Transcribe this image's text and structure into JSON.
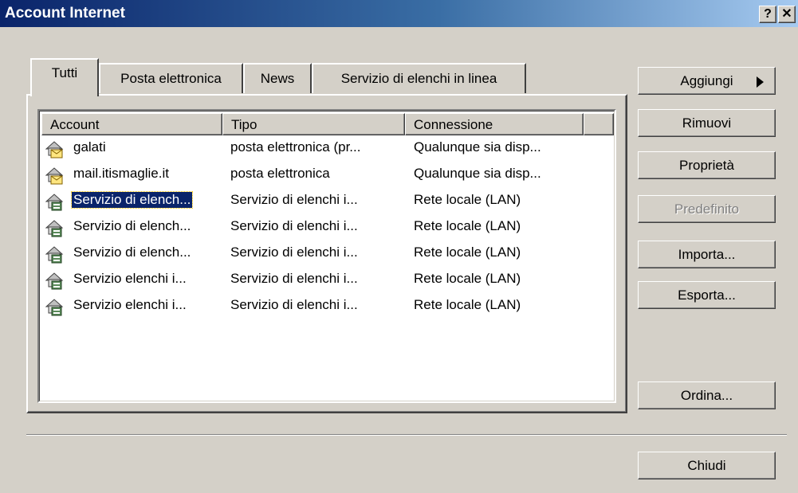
{
  "window": {
    "title": "Account Internet",
    "help_label": "?",
    "close_label": "✕"
  },
  "tabs": [
    {
      "label": "Tutti",
      "active": true
    },
    {
      "label": "Posta elettronica",
      "active": false
    },
    {
      "label": "News",
      "active": false
    },
    {
      "label": "Servizio di elenchi in linea",
      "active": false
    }
  ],
  "list": {
    "columns": [
      "Account",
      "Tipo",
      "Connessione"
    ],
    "rows": [
      {
        "icon": "mail-account-icon",
        "name": "galati",
        "tipo": "posta elettronica (pr...",
        "connessione": "Qualunque sia disp..."
      },
      {
        "icon": "mail-account-icon",
        "name": "mail.itismaglie.it",
        "tipo": "posta elettronica",
        "connessione": "Qualunque sia disp..."
      },
      {
        "icon": "directory-service-icon",
        "name": "Servizio di elench...",
        "tipo": "Servizio di elenchi i...",
        "connessione": "Rete locale (LAN)",
        "selected": true
      },
      {
        "icon": "directory-service-icon",
        "name": "Servizio di elench...",
        "tipo": "Servizio di elenchi i...",
        "connessione": "Rete locale (LAN)"
      },
      {
        "icon": "directory-service-icon",
        "name": "Servizio di elench...",
        "tipo": "Servizio di elenchi i...",
        "connessione": "Rete locale (LAN)"
      },
      {
        "icon": "directory-service-icon",
        "name": "Servizio elenchi i...",
        "tipo": "Servizio di elenchi i...",
        "connessione": "Rete locale (LAN)"
      },
      {
        "icon": "directory-service-icon",
        "name": "Servizio elenchi i...",
        "tipo": "Servizio di elenchi i...",
        "connessione": "Rete locale (LAN)"
      }
    ]
  },
  "buttons": {
    "aggiungi": "Aggiungi",
    "rimuovi": "Rimuovi",
    "proprieta": "Proprietà",
    "predefinito": "Predefinito",
    "importa": "Importa...",
    "esporta": "Esporta...",
    "ordina": "Ordina...",
    "chiudi": "Chiudi"
  },
  "colors": {
    "face": "#d4d0c8",
    "selection": "#0a246a",
    "title_start": "#0a246a",
    "title_end": "#a6caf0"
  }
}
